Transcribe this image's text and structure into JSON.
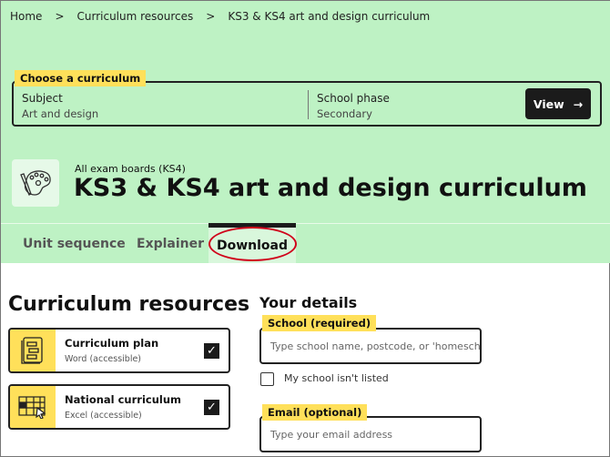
{
  "breadcrumb": [
    "Home",
    "Curriculum resources",
    "KS3 & KS4 art and design curriculum"
  ],
  "breadcrumb_sep": ">",
  "chooser": {
    "label": "Choose a curriculum",
    "subject_label": "Subject",
    "subject_value": "Art and design",
    "phase_label": "School phase",
    "phase_value": "Secondary",
    "view_label": "View",
    "view_icon": "arrow-right-icon"
  },
  "header": {
    "icon": "palette-icon",
    "eyebrow": "All exam boards (KS4)",
    "title": "KS3 & KS4 art and design curriculum"
  },
  "tabs": [
    {
      "label": "Unit sequence"
    },
    {
      "label": "Explainer"
    },
    {
      "label": "Download",
      "active": true
    }
  ],
  "resources": {
    "heading": "Curriculum resources",
    "items": [
      {
        "title": "Curriculum plan",
        "format": "Word (accessible)",
        "checked": true,
        "icon": "document-stack-icon"
      },
      {
        "title": "National curriculum",
        "format": "Excel (accessible)",
        "checked": true,
        "icon": "spreadsheet-icon"
      }
    ]
  },
  "details": {
    "heading": "Your details",
    "school_label": "School (required)",
    "school_placeholder": "Type school name, postcode, or 'homeschool'",
    "not_listed_label": "My school isn't listed",
    "email_label": "Email (optional)",
    "email_placeholder": "Type your email address"
  },
  "colors": {
    "hero": "#bef2c4",
    "highlight": "#ffe05a",
    "dark": "#1b1b1b",
    "annotation": "#d0021b"
  }
}
